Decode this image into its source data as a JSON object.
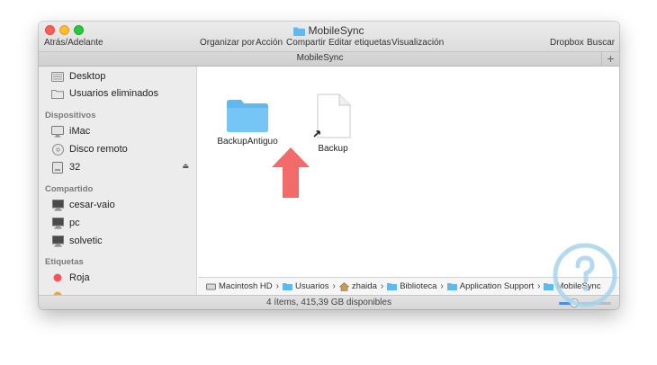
{
  "window": {
    "title": "MobileSync"
  },
  "toolbar": {
    "nav_label": "Atrás/Adelante",
    "organize_label": "Organizar por",
    "action_label": "Acción",
    "share_label": "Compartir",
    "tags_label": "Editar etiquetas",
    "view_label": "Visualización",
    "dropbox_label": "Dropbox",
    "search_label": "Buscar"
  },
  "tabbar": {
    "title": "MobileSync",
    "add_tab": "+"
  },
  "sidebar": {
    "favorites": [
      {
        "label": "Desktop",
        "icon": "desktop-icon"
      },
      {
        "label": "Usuarios eliminados",
        "icon": "folder-icon"
      }
    ],
    "devices_header": "Dispositivos",
    "devices": [
      {
        "label": "iMac",
        "icon": "computer-icon"
      },
      {
        "label": "Disco remoto",
        "icon": "disc-icon"
      },
      {
        "label": "32",
        "icon": "drive-icon",
        "eject": "⏏"
      }
    ],
    "shared_header": "Compartido",
    "shared": [
      {
        "label": "cesar-vaio",
        "icon": "network-computer-icon"
      },
      {
        "label": "pc",
        "icon": "network-computer-icon"
      },
      {
        "label": "solvetic",
        "icon": "network-computer-icon"
      }
    ],
    "tags_header": "Etiquetas",
    "tags": [
      {
        "label": "Roja",
        "color": "#f2555a"
      }
    ],
    "tag_partial_color": "#f5a623"
  },
  "content": {
    "items": [
      {
        "label": "BackupAntiguo",
        "kind": "folder",
        "color": "#5fb8f0"
      },
      {
        "label": "Backup",
        "kind": "alias-file"
      }
    ]
  },
  "pathbar": {
    "crumbs": [
      {
        "label": "Macintosh HD",
        "icon": "hard-drive-icon"
      },
      {
        "label": "Usuarios",
        "icon": "folder-icon"
      },
      {
        "label": "zhaida",
        "icon": "home-icon"
      },
      {
        "label": "Biblioteca",
        "icon": "folder-icon"
      },
      {
        "label": "Application Support",
        "icon": "folder-icon"
      },
      {
        "label": "MobileSync",
        "icon": "folder-icon"
      }
    ],
    "separator": "›"
  },
  "statusbar": {
    "text": "4 ítems, 415,39 GB disponibles",
    "zoom_fraction": 0.3
  },
  "annotation": {
    "arrow_color": "#f26a6a"
  },
  "watermark": {
    "color": "#a7d3ee"
  }
}
